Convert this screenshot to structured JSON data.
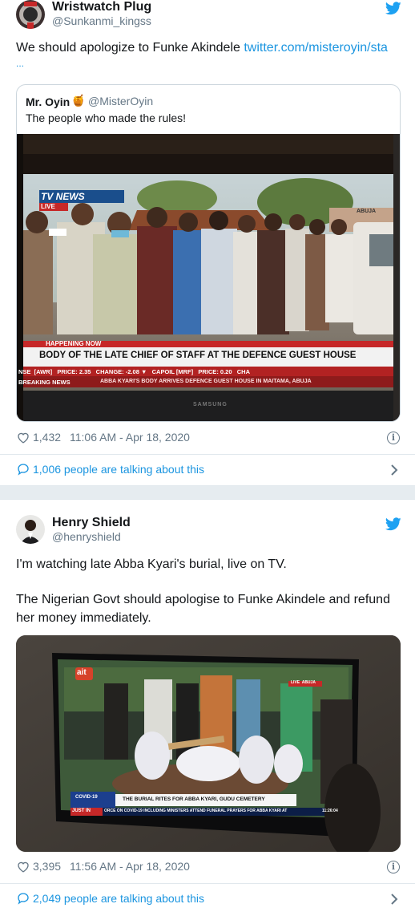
{
  "tweet1": {
    "name": "Wristwatch Plug",
    "handle": "@Sunkanmi_kingss",
    "text": "We should apologize to Funke Akindele ",
    "link": "twitter.com/misteroyin/sta",
    "ellipsis": "...",
    "quoted": {
      "name": "Mr. Oyin",
      "emoji": "🍯",
      "handle": "@MisterOyin",
      "text": "The people who made the rules!",
      "tv": {
        "channel": "TV NEWS",
        "live": "LIVE",
        "abuja": "ABUJA",
        "happening": "HAPPENING NOW",
        "headline": "BODY OF THE LATE CHIEF OF STAFF AT THE DEFENCE GUEST HOUSE",
        "ticker1": "NSE  [AWR]   PRICE: 2.35   CHANGE: -2.08 ▼   CAPOIL [MRF]   PRICE: 0.20   CHA",
        "breaking_label": "BREAKING NEWS",
        "breaking_text": "ABBA KYARI'S BODY ARRIVES DEFENCE GUEST HOUSE IN MAITAMA, ABUJA",
        "brand": "SAMSUNG"
      }
    },
    "likes": "1,432",
    "time": "11:06 AM - Apr 18, 2020",
    "talking": "1,006 people are talking about this"
  },
  "tweet2": {
    "name": "Henry Shield",
    "handle": "@henryshield",
    "text1": "I'm watching late Abba Kyari's burial, live on TV.",
    "text2": "The Nigerian Govt should apologise to Funke Akindele and refund her money immediately.",
    "tv": {
      "logo": "ait",
      "live": "LIVE  ABUJA",
      "covid": "COVID-19",
      "caption": "THE BURIAL RITES FOR ABBA KYARI, GUDU CEMETERY",
      "just_in": "JUST IN",
      "ticker": "ORCE ON COVID-19 INCLUDING MINISTERS ATTEND FUNERAL PRAYERS FOR ABBA KYARI AT",
      "clock": "11:26:04"
    },
    "likes": "3,395",
    "time": "11:56 AM - Apr 18, 2020",
    "talking": "2,049 people are talking about this"
  },
  "icons": {
    "bird": "twitter-bird-icon",
    "heart": "heart-icon",
    "info": "info-icon",
    "bubble": "comment-bubble-icon",
    "chevron": "chevron-right-icon"
  },
  "colors": {
    "twitter_blue": "#1b95e0",
    "gray": "#657786",
    "divider": "#e1e8ed"
  }
}
